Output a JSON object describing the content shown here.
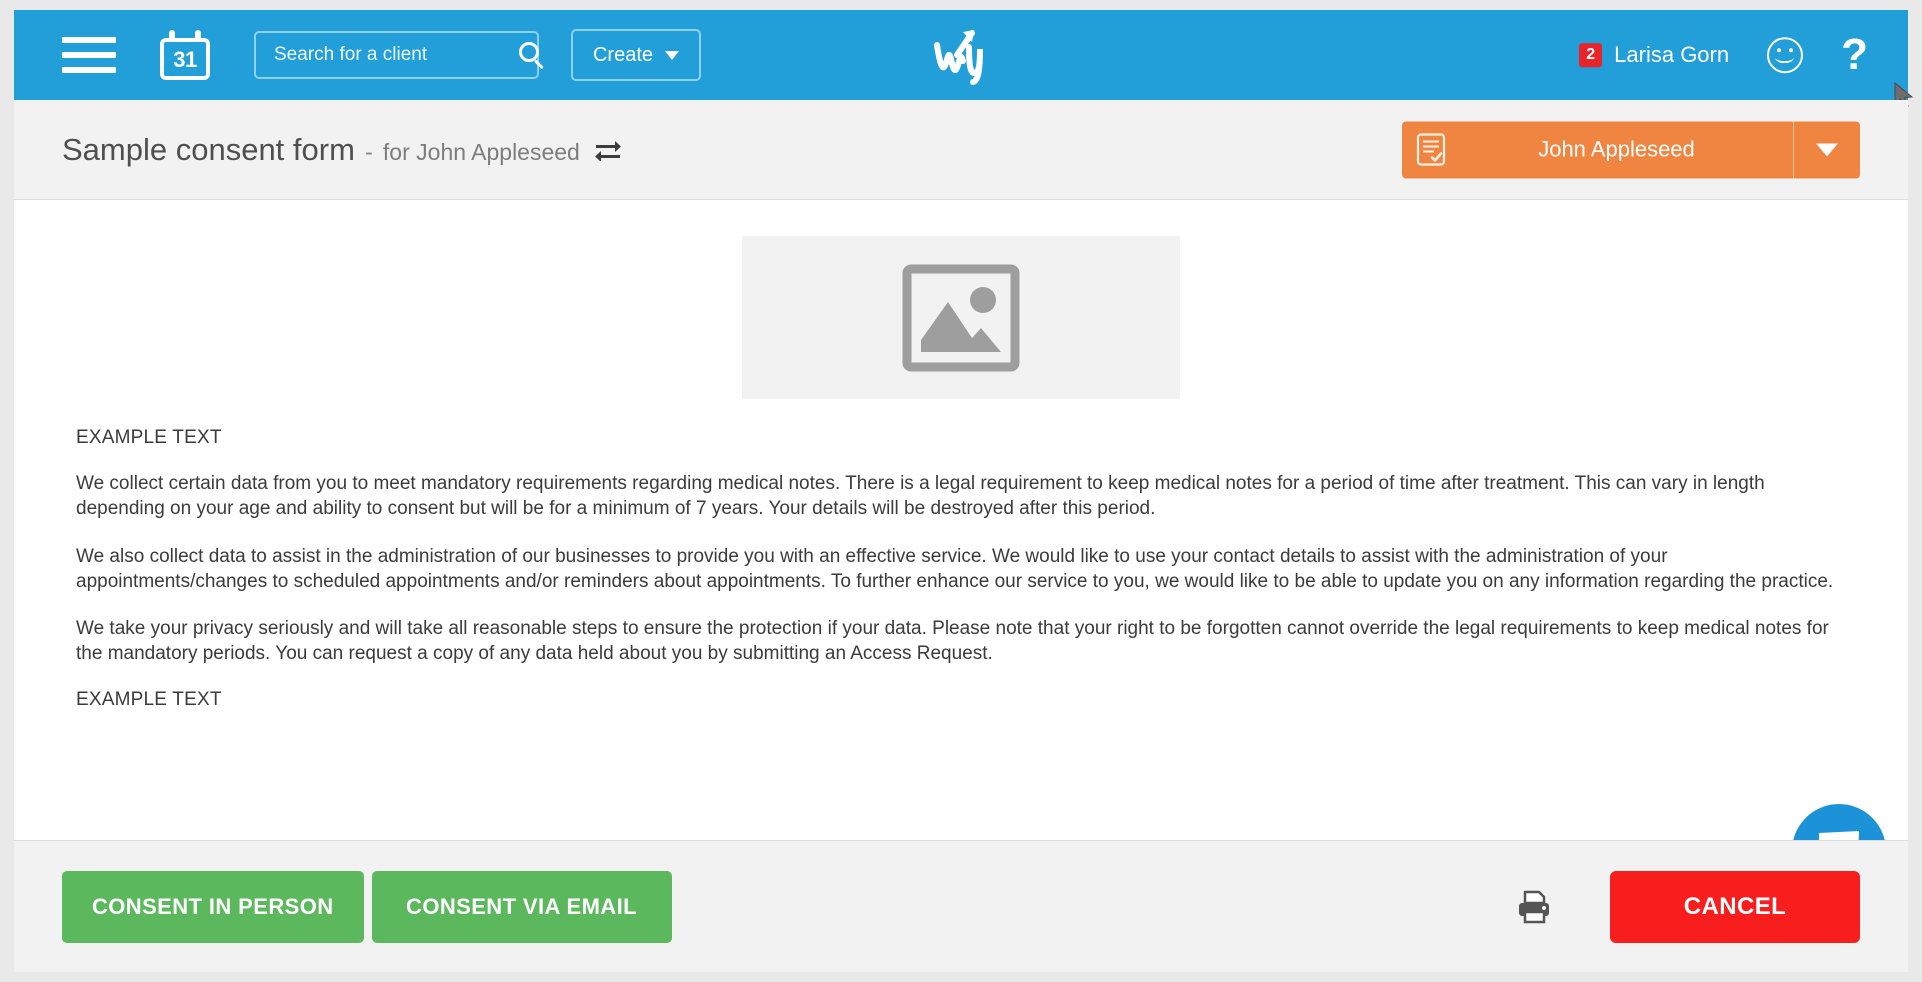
{
  "header": {
    "menu_icon": "hamburger-menu-icon",
    "calendar_icon": "calendar-icon",
    "calendar_day": "31",
    "search": {
      "placeholder": "Search for a client",
      "value": "",
      "icon": "search-icon"
    },
    "create_label": "Create",
    "create_chevron_icon": "chevron-down-icon",
    "logo": "writeupp-logo",
    "notification_count": "2",
    "user_name": "Larisa Gorn",
    "smiley_icon": "smiley-face-icon",
    "help_icon": "question-mark-help-icon",
    "bg_color": "#229ed9"
  },
  "subheader": {
    "title": "Sample consent form",
    "dash": "-",
    "subtitle": "for John Appleseed",
    "swap_icon": "swap-client-icon",
    "client_pill": {
      "doc_icon": "form-checklist-icon",
      "name": "John Appleseed",
      "chevron_icon": "chevron-down-icon",
      "color": "#ef8540"
    }
  },
  "content": {
    "image_placeholder_icon": "broken-image-placeholder-icon",
    "heading_top": "EXAMPLE TEXT",
    "paragraphs": [
      "We collect certain data from you to meet mandatory requirements regarding medical notes. There is a legal requirement to keep medical notes for a period of time after treatment. This can vary in length depending on your age and ability to consent but will be for a minimum of 7 years. Your details will be destroyed after this period.",
      "We also collect data to assist in the administration of our businesses to provide you with an effective service. We would like to use your contact details to assist with the administration of your appointments/changes to scheduled appointments and/or reminders about appointments. To further enhance our service to you, we would like to be able to update you on any information regarding the practice.",
      "We take your privacy seriously and will take all reasonable steps to ensure the protection if your data. Please note that your right to be forgotten cannot override the legal requirements to keep medical notes for the mandatory periods. You can request a copy of any data held about you by submitting an Access Request."
    ],
    "heading_bottom": "EXAMPLE TEXT",
    "chat_icon": "chat-bubble-icon"
  },
  "footer": {
    "consent_in_person_label": "CONSENT IN PERSON",
    "consent_via_email_label": "CONSENT VIA EMAIL",
    "print_icon": "printer-icon",
    "cancel_label": "CANCEL",
    "green_color": "#5cb85c",
    "red_color": "#f91e1e"
  }
}
